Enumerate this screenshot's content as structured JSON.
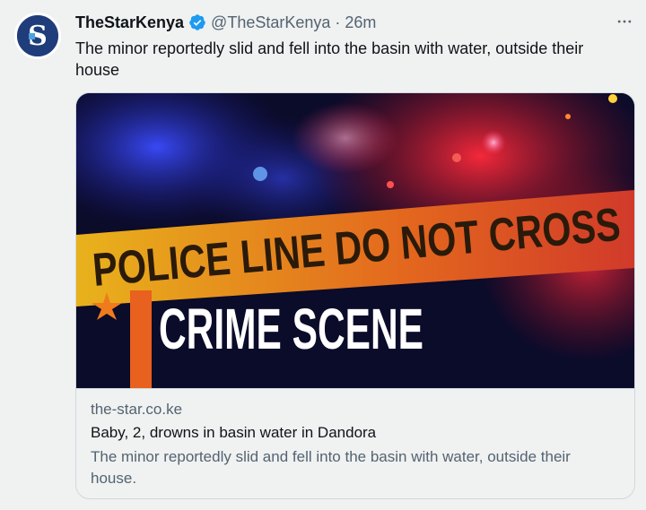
{
  "tweet": {
    "display_name": "TheStarKenya",
    "handle": "@TheStarKenya",
    "separator": "·",
    "time": "26m",
    "text": "The minor reportedly slid and fell into the basin with water, outside their house",
    "avatar_letter": "S"
  },
  "card": {
    "image_tape_text": "POLICE LINE DO NOT CROSS",
    "image_heading": "CRIME SCENE",
    "domain": "the-star.co.ke",
    "title": "Baby, 2, drowns in basin water in Dandora",
    "description": "The minor reportedly slid and fell into the basin with water, outside their house."
  },
  "icons": {
    "verified": "verified-badge-icon",
    "more": "more-options-icon"
  },
  "colors": {
    "verified": "#1d9bf0",
    "tape": "#f2a81d",
    "background": "#f0f1f1"
  }
}
